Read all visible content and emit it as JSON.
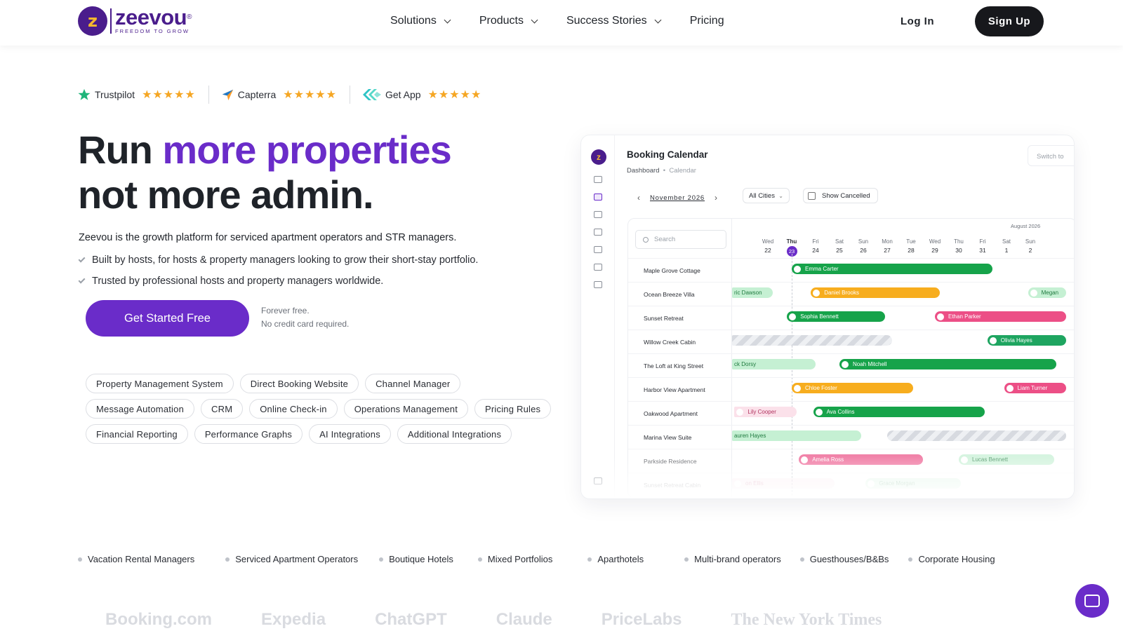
{
  "nav": {
    "logo_word": "zeevou",
    "logo_reg": "®",
    "logo_tagline": "FREEDOM TO GROW",
    "menu": [
      "Solutions",
      "Products",
      "Success Stories",
      "Pricing"
    ],
    "login": "Log In",
    "signup": "Sign Up"
  },
  "ratings": [
    {
      "name": "Trustpilot",
      "stars": "★★★★★",
      "icon": "trustpilot-star-icon",
      "color": "#1fb57a"
    },
    {
      "name": "Capterra",
      "stars": "★★★★★",
      "icon": "capterra-arrow-icon",
      "color": "#ff9d28"
    },
    {
      "name": "Get App",
      "stars": "★★★★★",
      "icon": "getapp-icon",
      "color": "#2ec4c6"
    }
  ],
  "hero": {
    "title_1": "Run ",
    "title_accent": "more properties",
    "title_2": "not more admin.",
    "lead": "Zeevou is the growth platform for serviced apartment operators and STR managers.",
    "checks": [
      "Built by hosts, for hosts & property managers looking to grow their short-stay portfolio.",
      "Trusted by professional hosts and property managers worldwide."
    ],
    "cta": "Get Started Free",
    "cta_note_1": "Forever free.",
    "cta_note_2": "No credit card required."
  },
  "chips": [
    [
      "Property Management System",
      "Direct Booking Website",
      "Channel Manager"
    ],
    [
      "Message Automation",
      "CRM",
      "Online Check-in",
      "Operations Management",
      "Pricing Rules"
    ],
    [
      "Financial Reporting",
      "Performance Graphs",
      "AI Integrations",
      "Additional Integrations"
    ]
  ],
  "mock": {
    "title": "Booking Calendar",
    "bread_1": "Dashboard",
    "bread_sep": "•",
    "bread_2": "Calendar",
    "switch": "Switch to",
    "month": "November 2026",
    "city": "All Cities",
    "show_cancelled": "Show Cancelled",
    "search": "Search",
    "month2": "August 2026",
    "days": [
      {
        "dn": "Wed",
        "dd": "22"
      },
      {
        "dn": "Thu",
        "dd": "23"
      },
      {
        "dn": "Fri",
        "dd": "24"
      },
      {
        "dn": "Sat",
        "dd": "25"
      },
      {
        "dn": "Sun",
        "dd": "26"
      },
      {
        "dn": "Mon",
        "dd": "27"
      },
      {
        "dn": "Tue",
        "dd": "28"
      },
      {
        "dn": "Wed",
        "dd": "29"
      },
      {
        "dn": "Thu",
        "dd": "30"
      },
      {
        "dn": "Fri",
        "dd": "31"
      },
      {
        "dn": "Sat",
        "dd": "1"
      },
      {
        "dn": "Sun",
        "dd": "2"
      }
    ],
    "properties": [
      "Maple Grove Cottage",
      "Ocean Breeze Villa",
      "Sunset Retreat",
      "Willow Creek Cabin",
      "The Loft at King Street",
      "Harbor View Apartment",
      "Oakwood Apartment",
      "Marina View Suite",
      "Parkside Residence",
      "Sunset Retreat Cabin"
    ],
    "bookings": [
      {
        "row": 0,
        "guest": "Emma Carter",
        "style": "green",
        "start": 2.5,
        "end": 10.9
      },
      {
        "row": 1,
        "guest": "ric Dawson",
        "style": "lgreen",
        "start": 0,
        "end": 1.7
      },
      {
        "row": 1,
        "guest": "Daniel Brooks",
        "style": "orange",
        "start": 3.3,
        "end": 8.7
      },
      {
        "row": 1,
        "guest": "Megan",
        "style": "lgreen",
        "start": 12.4,
        "end": 14
      },
      {
        "row": 2,
        "guest": "Sophia Bennett",
        "style": "green",
        "start": 2.3,
        "end": 6.4
      },
      {
        "row": 2,
        "guest": "Ethan Parker",
        "style": "pink",
        "start": 8.5,
        "end": 14
      },
      {
        "row": 3,
        "guest": "",
        "style": "hatch",
        "start": 0,
        "end": 6.7
      },
      {
        "row": 3,
        "guest": "Olivia Hayes",
        "style": "teal",
        "start": 10.7,
        "end": 14
      },
      {
        "row": 4,
        "guest": "ck Dorsy",
        "style": "lgreen",
        "start": 0,
        "end": 3.5
      },
      {
        "row": 4,
        "guest": "Noah Mitchell",
        "style": "green",
        "start": 4.5,
        "end": 13.6
      },
      {
        "row": 5,
        "guest": "Chloe Foster",
        "style": "orange",
        "start": 2.5,
        "end": 7.6
      },
      {
        "row": 5,
        "guest": "Liam Turner",
        "style": "pink",
        "start": 11.4,
        "end": 14
      },
      {
        "row": 6,
        "guest": "Lily Cooper",
        "style": "lpink",
        "start": 0.1,
        "end": 2.7
      },
      {
        "row": 6,
        "guest": "Ava Collins",
        "style": "green",
        "start": 3.4,
        "end": 10.6
      },
      {
        "row": 7,
        "guest": "auren Hayes",
        "style": "lgreen",
        "start": 0,
        "end": 5.4
      },
      {
        "row": 7,
        "guest": "",
        "style": "hatch",
        "start": 6.5,
        "end": 14
      },
      {
        "row": 8,
        "guest": "Amelia Ross",
        "style": "pink",
        "start": 2.8,
        "end": 8
      },
      {
        "row": 8,
        "guest": "Lucas Bennett",
        "style": "lgreen",
        "start": 9.5,
        "end": 13.5
      },
      {
        "row": 9,
        "guest": "on Ellis",
        "style": "lpink",
        "start": 0,
        "end": 4.3
      },
      {
        "row": 9,
        "guest": "Grace Morgan",
        "style": "lgreen",
        "start": 5.6,
        "end": 9.6
      }
    ]
  },
  "segments": [
    "Vacation Rental Managers",
    "Serviced Apartment Operators",
    "Boutique Hotels",
    "Mixed Portfolios",
    "Aparthotels",
    "Multi-brand operators",
    "Guesthouses/B&Bs",
    "Corporate Housing"
  ],
  "logos": [
    "Booking.com",
    "Expedia",
    "ChatGPT",
    "Claude",
    "PriceLabs",
    "The New York Times"
  ],
  "colors": {
    "brand": "#4a1d8c",
    "accent": "#6a2cc9",
    "star": "#f5a623"
  }
}
